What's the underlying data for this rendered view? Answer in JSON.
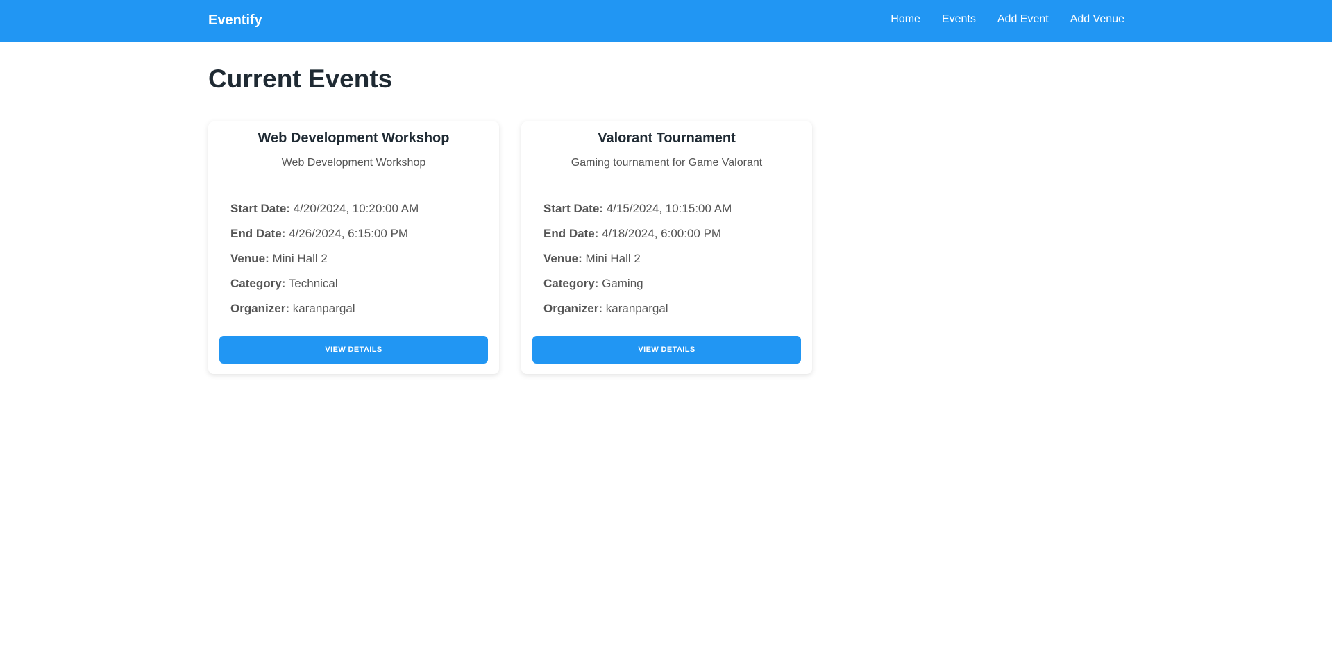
{
  "navbar": {
    "brand": "Eventify",
    "links": [
      {
        "label": "Home"
      },
      {
        "label": "Events"
      },
      {
        "label": "Add Event"
      },
      {
        "label": "Add Venue"
      }
    ]
  },
  "main": {
    "title": "Current Events"
  },
  "labels": {
    "start_date": "Start Date:",
    "end_date": "End Date:",
    "venue": "Venue:",
    "category": "Category:",
    "organizer": "Organizer:",
    "view_details": "VIEW DETAILS"
  },
  "events": [
    {
      "title": "Web Development Workshop",
      "description": "Web Development Workshop",
      "start_date": "4/20/2024, 10:20:00 AM",
      "end_date": "4/26/2024, 6:15:00 PM",
      "venue": "Mini Hall 2",
      "category": "Technical",
      "organizer": "karanpargal"
    },
    {
      "title": "Valorant Tournament",
      "description": "Gaming tournament for Game Valorant",
      "start_date": "4/15/2024, 10:15:00 AM",
      "end_date": "4/18/2024, 6:00:00 PM",
      "venue": "Mini Hall 2",
      "category": "Gaming",
      "organizer": "karanpargal"
    }
  ],
  "colors": {
    "primary": "#2196f3",
    "text_dark": "#1f2a33",
    "text_muted": "#555555"
  }
}
